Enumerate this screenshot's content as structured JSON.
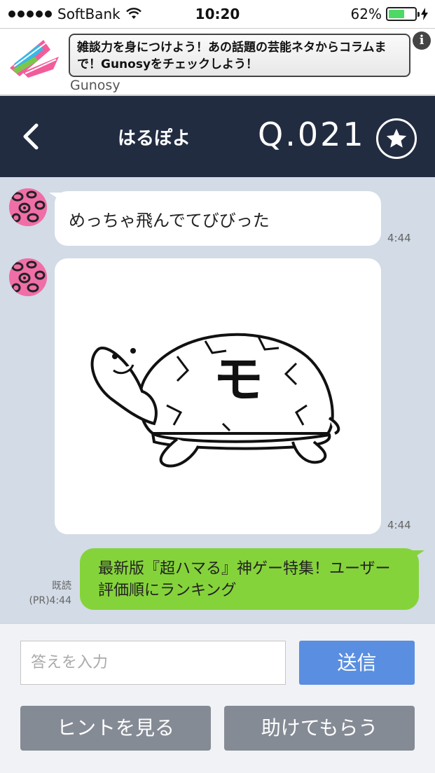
{
  "status_bar": {
    "carrier": "SoftBank",
    "time": "10:20",
    "battery": "62%",
    "battery_level": 0.62,
    "signal_icon": "signal-dots-icon",
    "wifi_icon": "wifi-icon",
    "charging_icon": "charging-bolt-icon"
  },
  "ad": {
    "text": "雑談力を身につけよう！あの話題の芸能ネタからコラムまで！Gunosyをチェックしよう！",
    "source": "Gunosy",
    "info_icon": "i"
  },
  "nav": {
    "back_icon": "chevron-left-icon",
    "title": "はるぽよ",
    "question_number": "Q.021",
    "star_icon": "star-icon",
    "background": "#222c41"
  },
  "chat": {
    "messages": [
      {
        "sender": "partner",
        "type": "text",
        "text": "めっちゃ飛んでてびびった",
        "time": "4:44"
      },
      {
        "sender": "partner",
        "type": "image",
        "image_icon": "turtle-illustration",
        "shell_char": "モ",
        "time": "4:44"
      },
      {
        "sender": "self",
        "type": "text",
        "text": "最新版『超ハマる』神ゲー特集！ユーザー評価順にランキング",
        "read": "既読",
        "time": "(PR)4:44"
      }
    ],
    "bubble_green": "#85d33a"
  },
  "input": {
    "placeholder": "答えを入力",
    "send_label": "送信",
    "hint_label": "ヒントを見る",
    "help_label": "助けてもらう",
    "send_color": "#5a8ee0"
  }
}
